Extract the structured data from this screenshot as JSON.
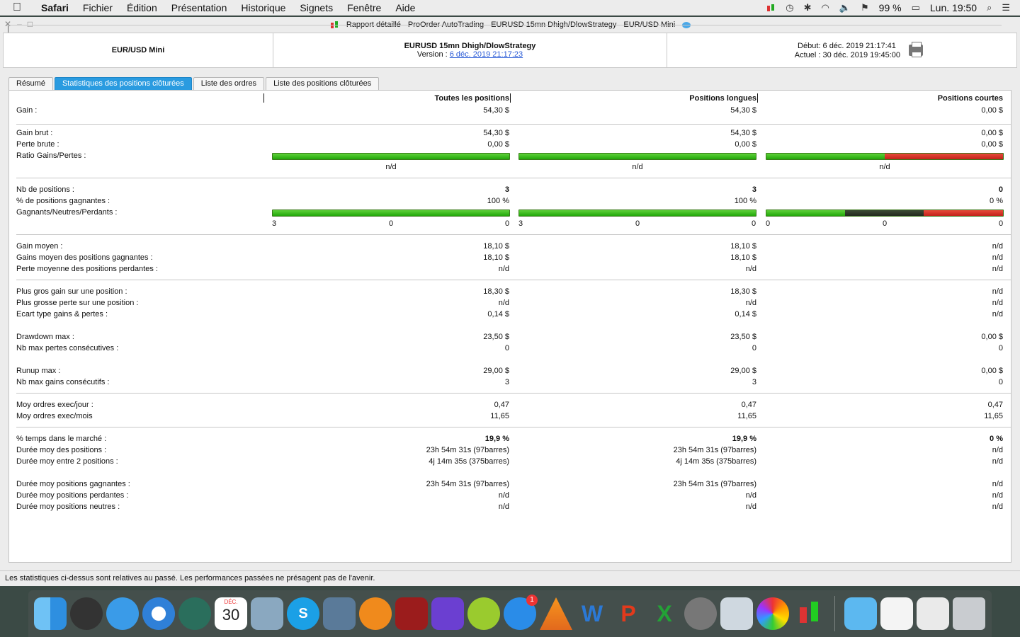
{
  "menubar": {
    "apple": "",
    "items": [
      "Safari",
      "Fichier",
      "Édition",
      "Présentation",
      "Historique",
      "Signets",
      "Fenêtre",
      "Aide"
    ],
    "battery": "99 %",
    "clock": "Lun. 19:50"
  },
  "window": {
    "titles": [
      "Rapport détaillé",
      "ProOrder AutoTrading",
      "EURUSD 15mn Dhigh/DlowStrategy",
      "EUR/USD Mini"
    ]
  },
  "header": {
    "instrument": "EUR/USD Mini",
    "strategy": "EURUSD 15mn Dhigh/DlowStrategy",
    "version_label": "Version :",
    "version_link": "6 déc. 2019 21:17:23",
    "start_label": "Début:",
    "start_value": "6 déc. 2019 21:17:41",
    "current_label": "Actuel :",
    "current_value": "30 déc. 2019 19:45:00"
  },
  "tabs": [
    "Résumé",
    "Statistiques des positions clôturées",
    "Liste des ordres",
    "Liste des positions clôturées"
  ],
  "columns": [
    "Toutes les positions",
    "Positions longues",
    "Positions courtes"
  ],
  "stats": {
    "gain": {
      "label": "Gain :",
      "values": [
        "54,30 $",
        "54,30 $",
        "0,00 $"
      ]
    },
    "gain_brut": {
      "label": "Gain brut :",
      "values": [
        "54,30 $",
        "54,30 $",
        "0,00 $"
      ]
    },
    "perte_brute": {
      "label": "Perte brute :",
      "values": [
        "0,00 $",
        "0,00 $",
        "0,00 $"
      ]
    },
    "ratio": {
      "label": "Ratio Gains/Pertes :",
      "values": [
        "n/d",
        "n/d",
        "n/d"
      ],
      "green_fraction": [
        1.0,
        1.0,
        0.5
      ]
    },
    "nb_positions": {
      "label": "Nb de positions :",
      "values": [
        "3",
        "3",
        "0"
      ]
    },
    "pct_gagnantes": {
      "label": "% de positions gagnantes :",
      "values": [
        "100 %",
        "100 %",
        "0 %"
      ]
    },
    "gnp": {
      "label": "Gagnants/Neutres/Perdants :",
      "counts": [
        [
          "3",
          "0",
          "0"
        ],
        [
          "3",
          "0",
          "0"
        ],
        [
          "0",
          "0",
          "0"
        ]
      ],
      "fractions": [
        [
          1,
          0,
          0
        ],
        [
          1,
          0,
          0
        ],
        [
          0.333,
          0.333,
          0.334
        ]
      ]
    },
    "gain_moyen": {
      "label": "Gain moyen :",
      "values": [
        "18,10 $",
        "18,10 $",
        "n/d"
      ]
    },
    "gain_moy_gagnantes": {
      "label": "Gains moyen des positions gagnantes :",
      "values": [
        "18,10 $",
        "18,10 $",
        "n/d"
      ]
    },
    "perte_moy_perdantes": {
      "label": "Perte moyenne des positions perdantes :",
      "values": [
        "n/d",
        "n/d",
        "n/d"
      ]
    },
    "plus_gros_gain": {
      "label": "Plus gros gain sur une position :",
      "values": [
        "18,30 $",
        "18,30 $",
        "n/d"
      ]
    },
    "plus_grosse_perte": {
      "label": "Plus grosse perte sur une position :",
      "values": [
        "n/d",
        "n/d",
        "n/d"
      ]
    },
    "ecart_type": {
      "label": "Ecart type gains & pertes :",
      "values": [
        "0,14 $",
        "0,14 $",
        "n/d"
      ]
    },
    "drawdown": {
      "label": "Drawdown max :",
      "values": [
        "23,50 $",
        "23,50 $",
        "0,00 $"
      ]
    },
    "nb_pertes_consec": {
      "label": "Nb max pertes consécutives :",
      "values": [
        "0",
        "0",
        "0"
      ]
    },
    "runup": {
      "label": "Runup max :",
      "values": [
        "29,00 $",
        "29,00 $",
        "0,00 $"
      ]
    },
    "nb_gains_consec": {
      "label": "Nb max gains consécutifs :",
      "values": [
        "3",
        "3",
        "0"
      ]
    },
    "moy_exec_jour": {
      "label": "Moy ordres exec/jour :",
      "values": [
        "0,47",
        "0,47",
        "0,47"
      ]
    },
    "moy_exec_mois": {
      "label": "Moy ordres exec/mois",
      "values": [
        "11,65",
        "11,65",
        "11,65"
      ]
    },
    "pct_temps": {
      "label": "% temps dans le marché :",
      "values": [
        "19,9 %",
        "19,9 %",
        "0 %"
      ]
    },
    "duree_moy_pos": {
      "label": "Durée moy des positions :",
      "values": [
        "23h 54m 31s (97barres)",
        "23h 54m 31s (97barres)",
        "n/d"
      ]
    },
    "duree_moy_entre": {
      "label": "Durée moy entre 2 positions :",
      "values": [
        "4j 14m 35s (375barres)",
        "4j 14m 35s (375barres)",
        "n/d"
      ]
    },
    "duree_gagnantes": {
      "label": "Durée moy positions gagnantes :",
      "values": [
        "23h 54m 31s (97barres)",
        "23h 54m 31s (97barres)",
        "n/d"
      ]
    },
    "duree_perdantes": {
      "label": "Durée moy positions perdantes :",
      "values": [
        "n/d",
        "n/d",
        "n/d"
      ]
    },
    "duree_neutres": {
      "label": "Durée moy positions neutres :",
      "values": [
        "n/d",
        "n/d",
        "n/d"
      ]
    }
  },
  "footer": "Les statistiques ci-dessus sont relatives au passé. Les performances passées ne présagent pas de l'avenir.",
  "dock": {
    "calendar_month": "DÉC.",
    "calendar_day": "30",
    "appstore_badge": "1"
  }
}
